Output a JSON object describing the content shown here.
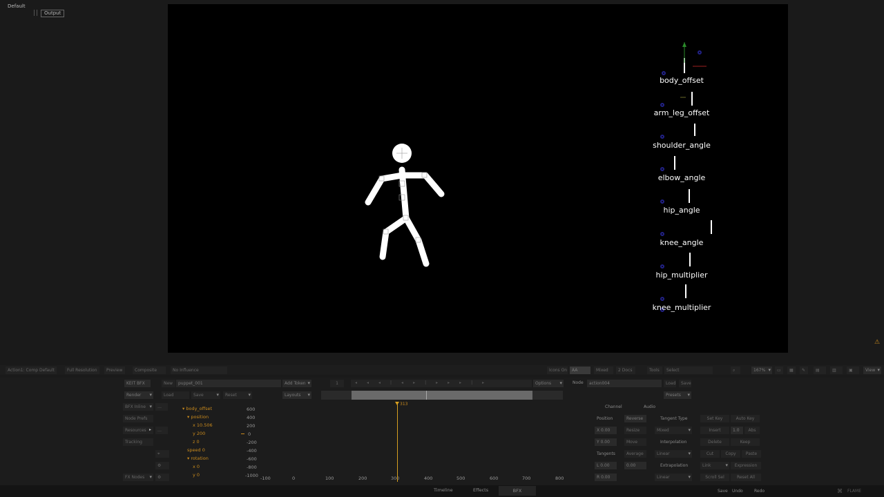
{
  "top": {
    "workspace": "Default",
    "view_button": "Output"
  },
  "viewer_labels": [
    "body_offset",
    "arm_leg_offset",
    "shoulder_angle",
    "elbow_angle",
    "hip_angle",
    "knee_angle",
    "hip_multiplier",
    "knee_multiplier"
  ],
  "viewer_bar": {
    "items": [
      "Action1: Comp Default",
      "Full Resolution",
      "Preview",
      "Composite",
      "No Influence"
    ],
    "right": [
      "Icons On",
      "AA",
      "Mixed",
      "2 Docs",
      "Tools",
      "Select"
    ],
    "zoom": "167%",
    "view": "View"
  },
  "panel_row1": {
    "setup_label": "KEIT BFX",
    "new_label": "New",
    "name_value": "puppet_001",
    "add_token": "Add Token",
    "frame": "1",
    "options": "Options",
    "node_label": "Node",
    "node_value": "action004",
    "load": "Load",
    "save": "Save"
  },
  "panel_row2": {
    "render": "Render",
    "load": "Load",
    "save": "Save",
    "reset": "Reset",
    "layouts": "Layouts",
    "presets": "Presets"
  },
  "left_buttons": [
    "BFX Inline",
    "Node Prefs",
    "Resources",
    "Tracking",
    "FX Nodes"
  ],
  "tree": [
    {
      "label": "body_offset",
      "indent": 0,
      "arrow": true
    },
    {
      "label": "position",
      "indent": 1,
      "arrow": true
    },
    {
      "label": "x 10.506",
      "indent": 2,
      "arrow": false
    },
    {
      "label": "y 200",
      "indent": 2,
      "arrow": false
    },
    {
      "label": "z 0",
      "indent": 2,
      "arrow": false
    },
    {
      "label": "speed 0",
      "indent": 1,
      "arrow": false
    },
    {
      "label": "rotation",
      "indent": 1,
      "arrow": true
    },
    {
      "label": "x 0",
      "indent": 2,
      "arrow": false
    },
    {
      "label": "y 0",
      "indent": 2,
      "arrow": false
    }
  ],
  "graph": {
    "y_ticks": [
      "600",
      "400",
      "200",
      "0",
      "-200",
      "-400",
      "-600",
      "-800",
      "-1000"
    ],
    "x_ticks": [
      "-100",
      "0",
      "100",
      "200",
      "300",
      "400",
      "500",
      "600",
      "700",
      "800"
    ],
    "playhead": "313"
  },
  "channel_panel": {
    "tabs": [
      "Channel",
      "Audio"
    ],
    "position": "Position",
    "reverse": "Reverse",
    "x": "X 0.00",
    "y": "Y 0.00",
    "resize": "Resize",
    "move": "Move",
    "tangents": "Tangents",
    "average": "Average",
    "l_val": "L 0.00",
    "r_val": "0.00",
    "r2": "R 0.00",
    "tangent_type": "Tangent Type",
    "mixed": "Mixed",
    "interpolation": "Interpolation",
    "linear": "Linear",
    "extrapolation": "Extrapolation",
    "linear2": "Linear",
    "set_key": "Set Key",
    "auto_key": "Auto Key",
    "insert": "Insert",
    "one": "1.0",
    "abs": "Abs",
    "delete": "Delete",
    "keep": "Keep",
    "cut": "Cut",
    "copy": "Copy",
    "paste": "Paste",
    "link": "Link",
    "expression": "Expression",
    "scroll_sel": "Scroll Sel",
    "reset_all": "Reset All"
  },
  "bottom": {
    "tabs": [
      "Timeline",
      "Effects",
      "BFX"
    ],
    "right": [
      "Save",
      "Undo",
      "Redo"
    ],
    "brand": "FLAME"
  }
}
